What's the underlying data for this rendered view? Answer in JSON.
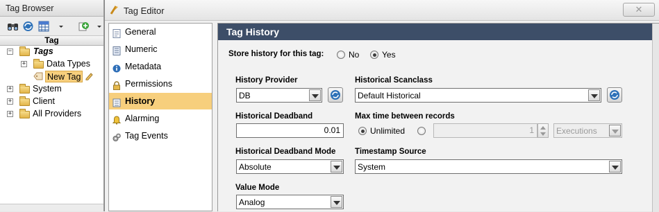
{
  "tag_browser": {
    "title": "Tag Browser",
    "column_header": "Tag",
    "toolbar": {
      "icons": [
        "binoculars-icon",
        "refresh-globe-icon",
        "grid-icon",
        "dropdown-arrow-icon",
        "add-tag-icon",
        "dropdown-arrow-icon"
      ]
    },
    "tree": [
      {
        "label": "Tags",
        "expanded": true,
        "italic_bold": true
      },
      {
        "label": "Data Types",
        "expanded": false
      },
      {
        "label": "New Tag",
        "selected": true
      },
      {
        "label": "System",
        "expanded": false
      },
      {
        "label": "Client",
        "expanded": false
      },
      {
        "label": "All Providers",
        "expanded": false
      }
    ]
  },
  "tag_editor": {
    "title": "Tag Editor",
    "close_glyph": "✕",
    "nav": [
      {
        "label": "General",
        "icon": "document-icon"
      },
      {
        "label": "Numeric",
        "icon": "numeric-icon"
      },
      {
        "label": "Metadata",
        "icon": "info-icon"
      },
      {
        "label": "Permissions",
        "icon": "lock-icon"
      },
      {
        "label": "History",
        "icon": "history-icon",
        "active": true
      },
      {
        "label": "Alarming",
        "icon": "alarm-bell-icon"
      },
      {
        "label": "Tag Events",
        "icon": "gears-icon"
      }
    ],
    "panel": {
      "header": "Tag History",
      "store_history": {
        "label": "Store history for this tag:",
        "options": [
          "No",
          "Yes"
        ],
        "selected": "Yes"
      },
      "history_provider": {
        "label": "History Provider",
        "value": "DB"
      },
      "historical_scanclass": {
        "label": "Historical Scanclass",
        "value": "Default Historical"
      },
      "historical_deadband": {
        "label": "Historical Deadband",
        "value": "0.01"
      },
      "max_time_between_records": {
        "label": "Max time between records",
        "unlimited_label": "Unlimited",
        "selected": "Unlimited",
        "count": "1",
        "unit": "Executions"
      },
      "deadband_mode": {
        "label": "Historical Deadband Mode",
        "value": "Absolute"
      },
      "timestamp_source": {
        "label": "Timestamp Source",
        "value": "System"
      },
      "value_mode": {
        "label": "Value Mode",
        "value": "Analog"
      }
    }
  },
  "colors": {
    "panel_header_bg": "#3d4e68",
    "nav_active_bg": "#f7cf7d",
    "selected_tag_bg": "#f7cf7d"
  }
}
